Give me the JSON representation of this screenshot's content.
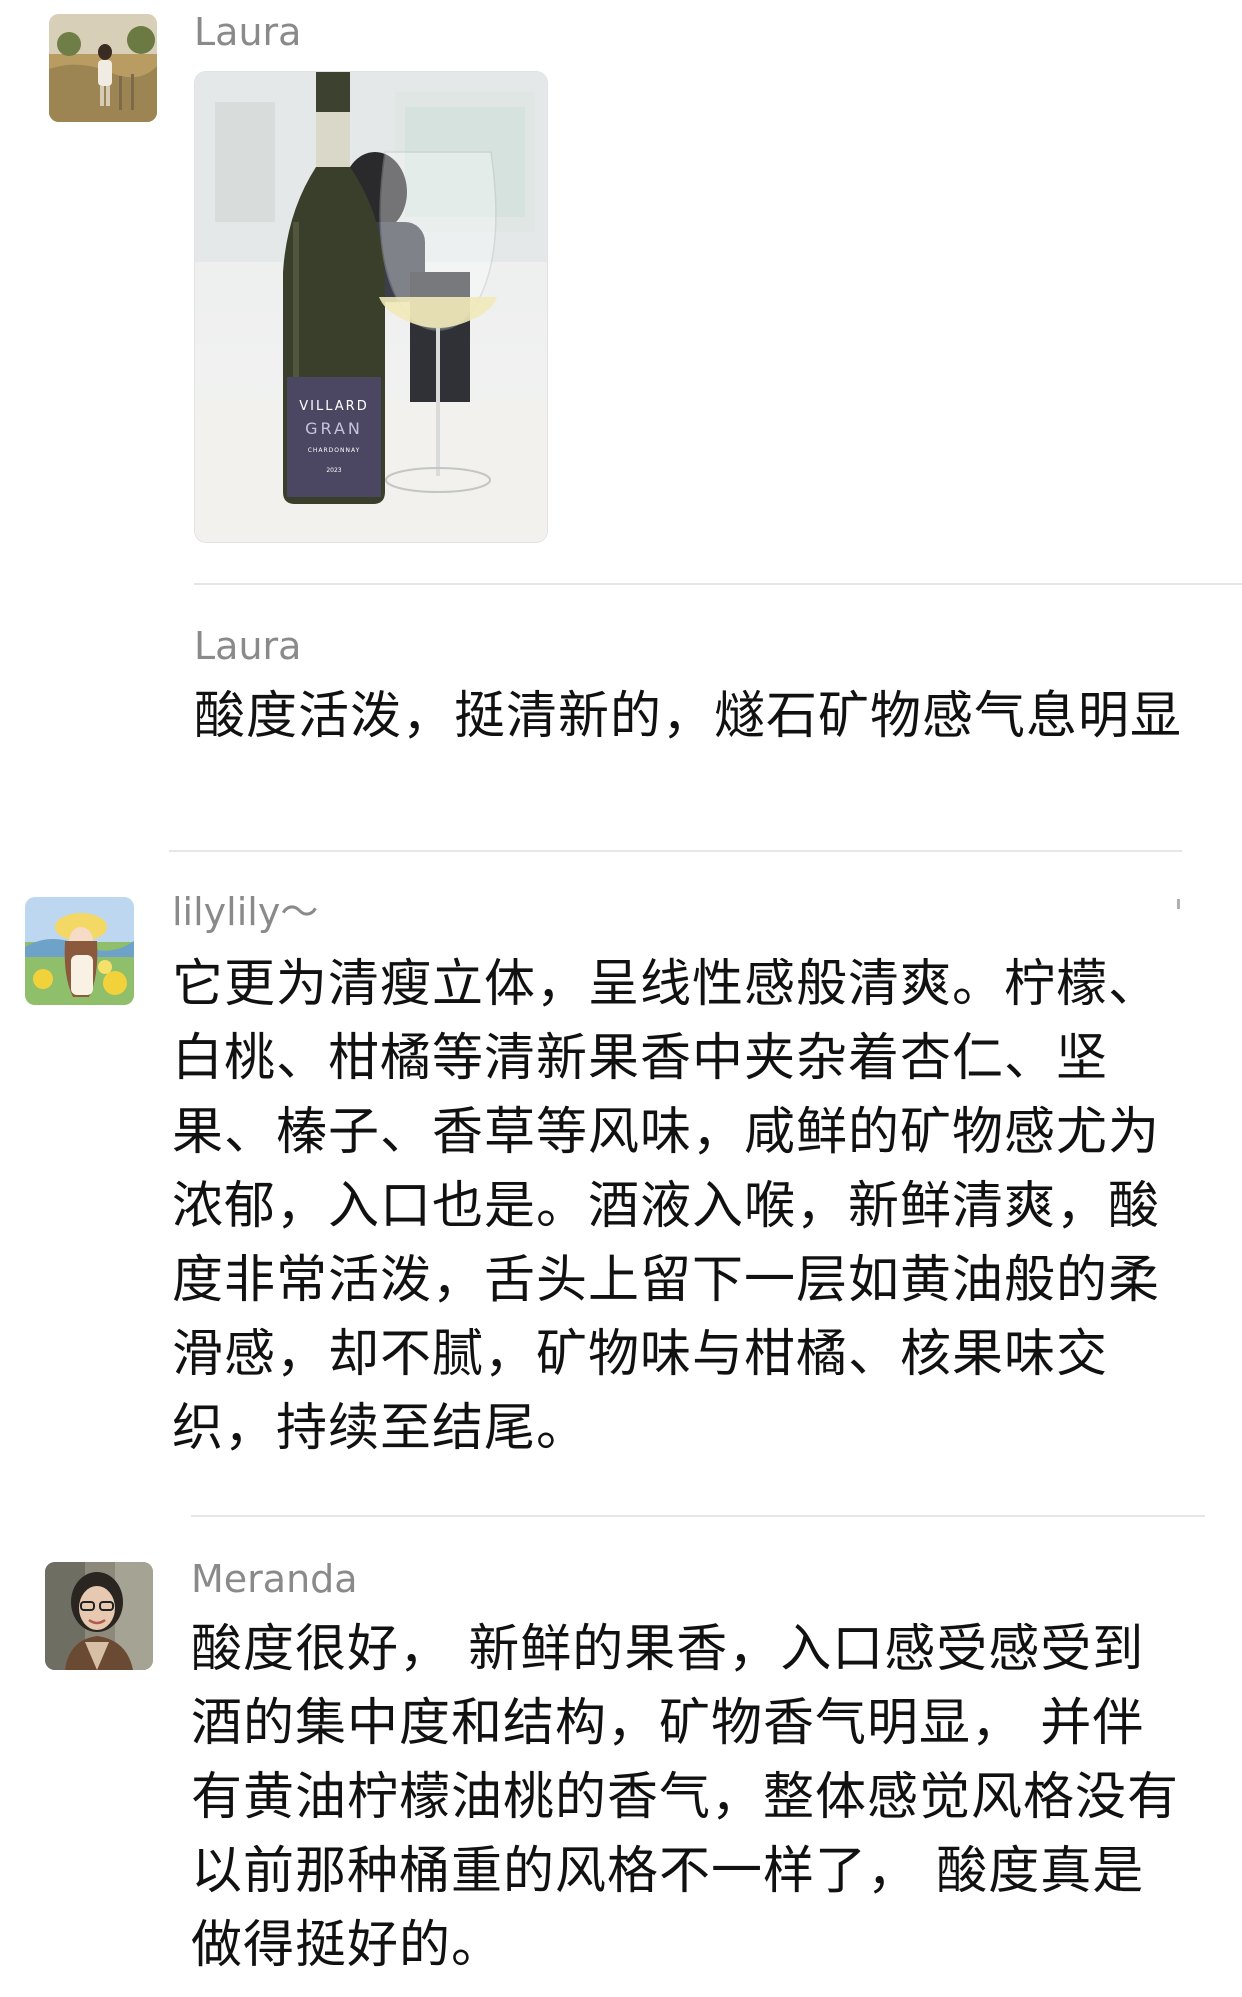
{
  "messages": [
    {
      "sender": "Laura",
      "type": "image",
      "image": {
        "bottle_label_lines": [
          "VILLARD",
          "GRAN",
          "CHARDONNAY",
          "2023"
        ]
      }
    },
    {
      "sender": "Laura",
      "type": "text",
      "text": "酸度活泼，挺清新的，燧石矿物感气息明显"
    },
    {
      "sender": "lilylily～",
      "type": "text",
      "text": "它更为清瘦立体，呈线性感般清爽。柠檬、白桃、柑橘等清新果香中夹杂着杏仁、坚果、榛子、香草等风味，咸鲜的矿物感尤为浓郁，入口也是。酒液入喉，新鲜清爽，酸度非常活泼，舌头上留下一层如黄油般的柔滑感，却不腻，矿物味与柑橘、核果味交织，持续至结尾。"
    },
    {
      "sender": "Meranda",
      "type": "text",
      "text": "酸度很好， 新鲜的果香，入口感受感受到酒的集中度和结构，矿物香气明显， 并伴有黄油柠檬油桃的香气，整体感觉风格没有以前那种桶重的风格不一样了， 酸度真是做得挺好的。"
    }
  ]
}
